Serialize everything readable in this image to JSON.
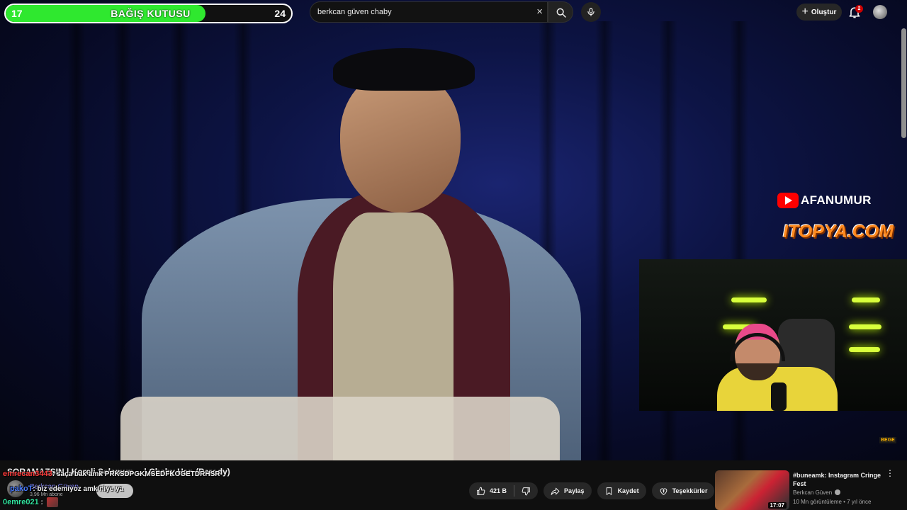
{
  "donation": {
    "left_value": "17",
    "label": "BAĞIŞ KUTUSU",
    "right_value": "24",
    "progress_percent": 70
  },
  "search": {
    "query": "berkcan güven chaby",
    "clear_icon": "×"
  },
  "header": {
    "create_label": "Oluştur",
    "notification_count": "2"
  },
  "overlay": {
    "channel_name": "AFANUMUR",
    "sponsor": "ITOPYA.COM",
    "webcam_tag": "BEGE"
  },
  "video": {
    "title": "SORAMAZSIN | Koreli Selamun… | Chaby Han (Parody)",
    "owner_name": "Berkcan Güven",
    "owner_subs": "3,96 Mn abone"
  },
  "chat": [
    {
      "user": "emrecan3443",
      "message": ": saça bak amk PRKSDPGKMSEDFKOGETDRHSR",
      "color": "#ff3b3b"
    },
    {
      "user": "pakoT",
      "message": ": biz edemiyoz amk niye ya",
      "color": "#4a7bff"
    },
    {
      "user": "0emre021",
      "message": " :",
      "color": "#33e6a0"
    }
  ],
  "actions": {
    "likes": "421 B",
    "share": "Paylaş",
    "save": "Kaydet",
    "thanks": "Teşekkürler",
    "more": "•••"
  },
  "recommendation": {
    "title": "#buneamk: Instagram Cringe Fest",
    "channel": "Berkcan Güven",
    "meta": "10 Mn görüntüleme • 7 yıl önce",
    "duration": "17:07",
    "menu": "⋮"
  },
  "colors": {
    "donation_fill": "#2fe82f",
    "bell_badge": "#cc0000",
    "sponsor": "#ff8a1f",
    "youtube_red": "#ff0000"
  }
}
